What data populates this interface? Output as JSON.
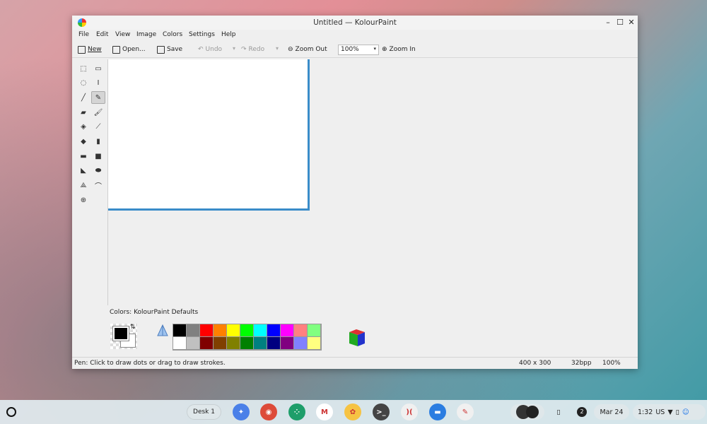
{
  "window": {
    "title": "Untitled  — KolourPaint",
    "controls": [
      "–",
      "☐",
      "✕"
    ]
  },
  "menubar": {
    "items": [
      "File",
      "Edit",
      "View",
      "Image",
      "Colors",
      "Settings",
      "Help"
    ]
  },
  "toolbar": {
    "new_label": "New",
    "open_label": "Open...",
    "save_label": "Save",
    "undo_label": "Undo",
    "redo_label": "Redo",
    "zoom_out_label": "Zoom Out",
    "zoom_value": "100%",
    "zoom_in_label": "Zoom In"
  },
  "tools": [
    {
      "name": "free-select-icon",
      "glyph": "⬚"
    },
    {
      "name": "rect-select-icon",
      "glyph": "▭"
    },
    {
      "name": "ellipse-select-icon",
      "glyph": "◌"
    },
    {
      "name": "text-icon",
      "glyph": "I"
    },
    {
      "name": "line-icon",
      "glyph": "╱"
    },
    {
      "name": "pen-icon",
      "glyph": "✎",
      "selected": true
    },
    {
      "name": "eraser-icon",
      "glyph": "▰"
    },
    {
      "name": "brush-icon",
      "glyph": "🖌"
    },
    {
      "name": "flood-fill-icon",
      "glyph": "◈"
    },
    {
      "name": "color-picker-icon",
      "glyph": "⟋"
    },
    {
      "name": "color-eraser-icon",
      "glyph": "◆"
    },
    {
      "name": "spraycan-icon",
      "glyph": "▮"
    },
    {
      "name": "rounded-rect-icon",
      "glyph": "▬"
    },
    {
      "name": "rectangle-icon",
      "glyph": "■"
    },
    {
      "name": "polygon-icon",
      "glyph": "◣"
    },
    {
      "name": "ellipse-icon",
      "glyph": "⬬"
    },
    {
      "name": "polyline-icon",
      "glyph": "⟁"
    },
    {
      "name": "curve-icon",
      "glyph": "⌒"
    },
    {
      "name": "zoom-icon",
      "glyph": "⊕"
    }
  ],
  "colors": {
    "label": "Colors: KolourPaint Defaults",
    "foreground": "#000000",
    "background": "#ffffff",
    "palette_top": [
      "#000000",
      "#808080",
      "#ff0000",
      "#ff8000",
      "#ffff00",
      "#00ff00",
      "#00ffff",
      "#0000ff",
      "#ff00ff",
      "#ff8080",
      "#80ff80"
    ],
    "palette_bottom": [
      "#ffffff",
      "#c0c0c0",
      "#800000",
      "#804000",
      "#808000",
      "#008000",
      "#008080",
      "#000080",
      "#800080",
      "#8080ff",
      "#ffff80"
    ]
  },
  "status": {
    "message": "Pen: Click to draw dots or drag to draw strokes.",
    "size": "400 x 300",
    "depth": "32bpp",
    "zoom": "100%"
  },
  "shelf": {
    "desk_label": "Desk 1",
    "apps": [
      {
        "name": "assistant-icon",
        "color": "#4a80e8",
        "glyph": "✦"
      },
      {
        "name": "chrome-icon",
        "color": "#dd4b39",
        "glyph": "◉"
      },
      {
        "name": "app-grid-icon",
        "color": "#1e9e6a",
        "glyph": "⁘"
      },
      {
        "name": "gmail-icon",
        "color": "#ffffff",
        "glyph": "M"
      },
      {
        "name": "photos-icon",
        "color": "#f6c343",
        "glyph": "✿"
      },
      {
        "name": "terminal-icon",
        "color": "#444444",
        "glyph": ">_"
      },
      {
        "name": "nearby-share-icon",
        "color": "#f0f0f0",
        "glyph": ")("
      },
      {
        "name": "files-icon",
        "color": "#2a7de1",
        "glyph": "▬"
      },
      {
        "name": "kolourpaint-icon",
        "color": "#f0f0f0",
        "glyph": "✎"
      }
    ],
    "notification_count": "2",
    "date": "Mar 24",
    "time": "1:32",
    "locale": "US"
  }
}
